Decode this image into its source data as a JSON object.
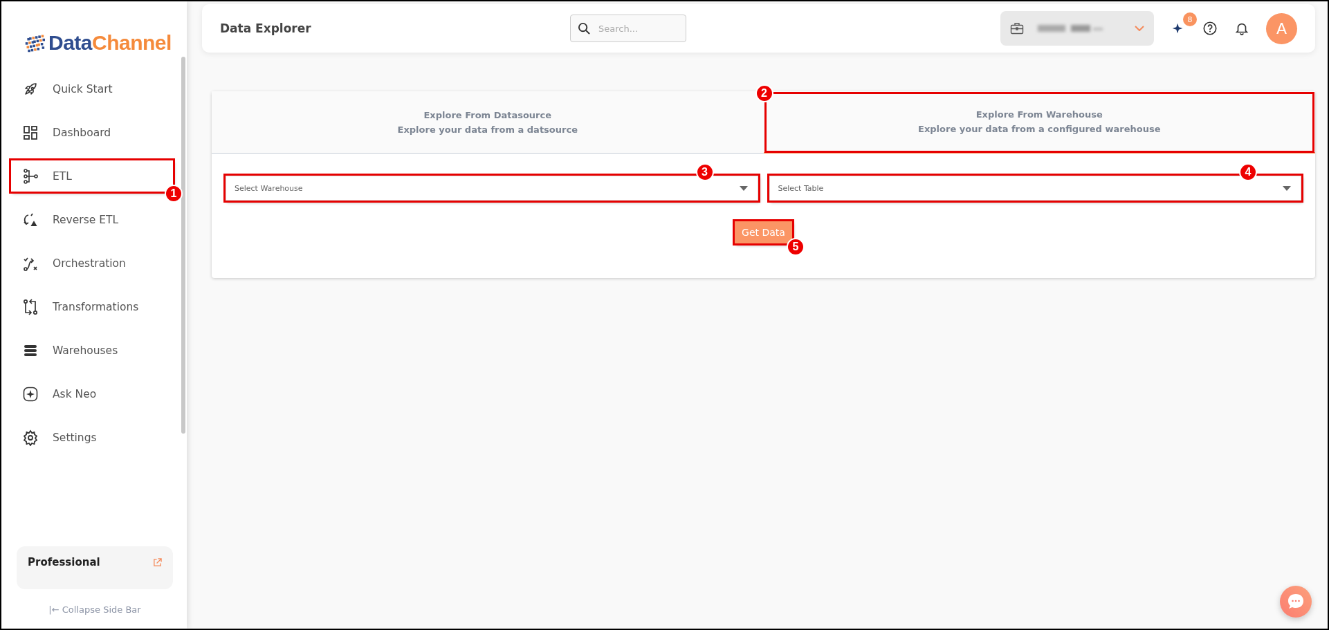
{
  "logo": {
    "text_1": "Data",
    "text_2": "Channel"
  },
  "sidebar": {
    "items": [
      {
        "label": "Quick Start",
        "selected": false
      },
      {
        "label": "Dashboard",
        "selected": false
      },
      {
        "label": "ETL",
        "selected": false,
        "marker": "1"
      },
      {
        "label": "Reverse ETL",
        "selected": false
      },
      {
        "label": "Orchestration",
        "selected": false
      },
      {
        "label": "Transformations",
        "selected": false
      },
      {
        "label": "Warehouses",
        "selected": false
      },
      {
        "label": "Ask Neo",
        "selected": false
      },
      {
        "label": "Settings",
        "selected": false
      }
    ],
    "plan": {
      "label": "Professional"
    },
    "collapse": "|← Collapse Side Bar"
  },
  "header": {
    "title": "Data Explorer",
    "search": {
      "placeholder": "Search..."
    },
    "notification_count": "8",
    "avatar": "A"
  },
  "tabs": [
    {
      "title": "Explore From Datasource",
      "subtitle": "Explore your data from a datsource",
      "selected": false
    },
    {
      "title": "Explore From Warehouse",
      "subtitle": "Explore your data from a configured warehouse",
      "selected": true,
      "marker": "2"
    }
  ],
  "selects": [
    {
      "placeholder": "Select Warehouse",
      "marker": "3"
    },
    {
      "placeholder": "Select Table",
      "marker": "4"
    }
  ],
  "get_data": {
    "label": "Get Data",
    "marker": "5"
  }
}
